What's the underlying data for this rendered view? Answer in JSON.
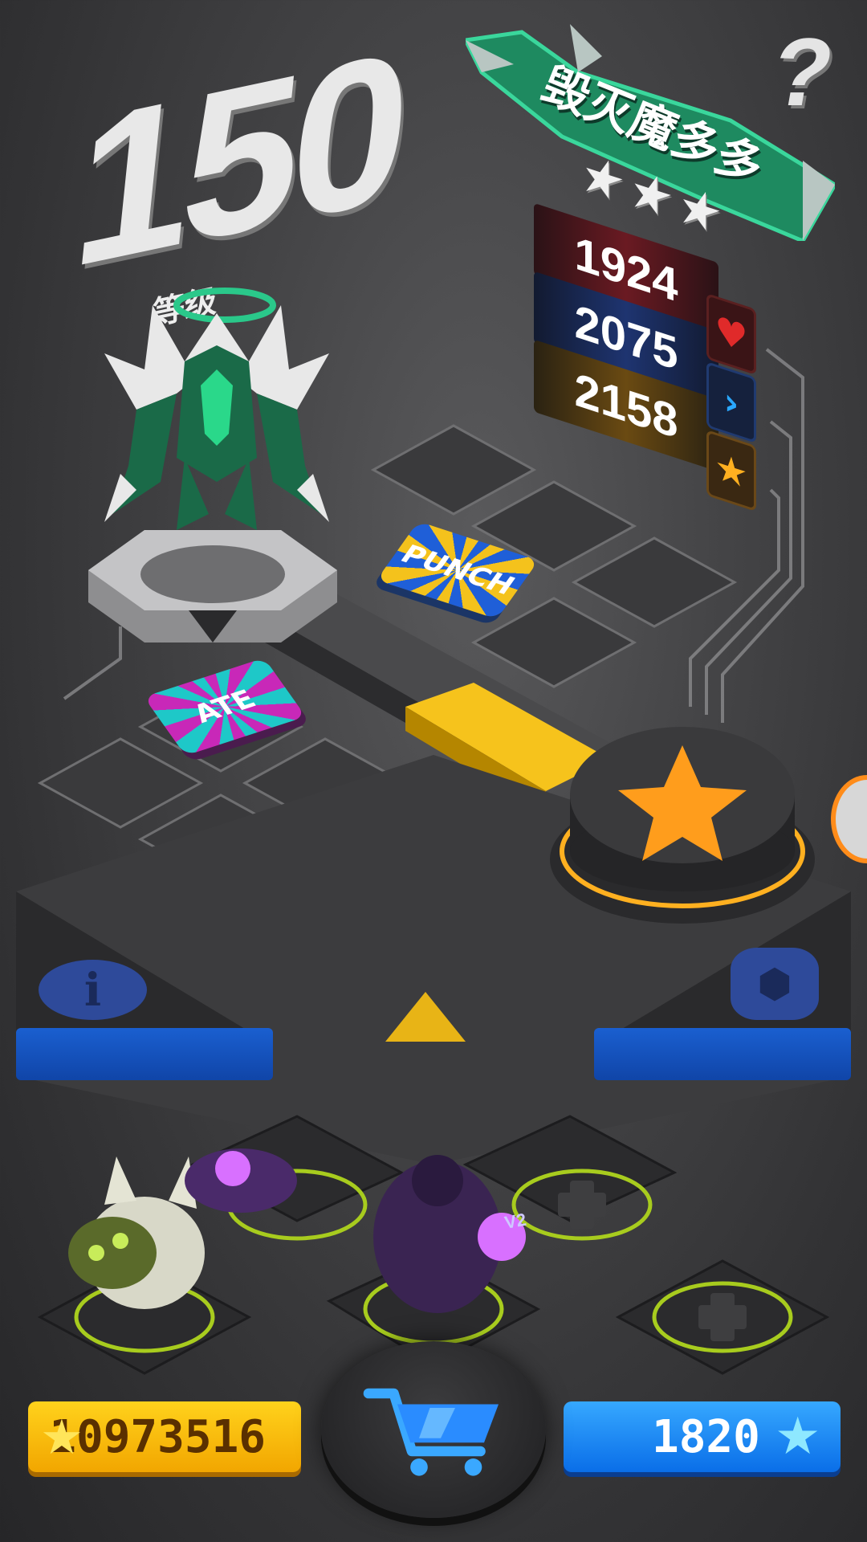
{
  "monster": {
    "level": "150",
    "level_caption": "等级",
    "name": "毁灭魔多多",
    "stars": 3
  },
  "stats": {
    "hp": "1924",
    "speed": "2075",
    "attack": "2158"
  },
  "icons": {
    "help": "question-mark-icon",
    "hp": "heart-icon",
    "speed": "chevron-right-icon",
    "attack": "star-icon",
    "info": "info-icon",
    "team": "dice-icon",
    "shop": "cart-icon"
  },
  "badges": {
    "blue": "PUNCH",
    "pink": "ATE"
  },
  "currency": {
    "coins": "10973516",
    "gems": "1820"
  },
  "colors": {
    "accent_yellow": "#f2b800",
    "accent_blue": "#1a6fe0",
    "banner_green": "#1e8a60",
    "bg": "#404042"
  },
  "team_label": "V2"
}
